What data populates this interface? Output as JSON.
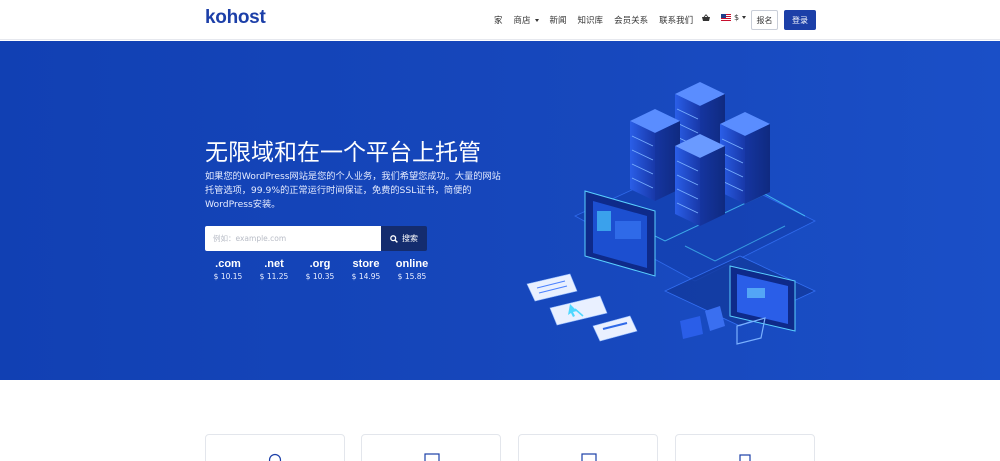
{
  "header": {
    "logo": "kohost",
    "nav": [
      {
        "label": "家",
        "dropdown": false
      },
      {
        "label": "商店",
        "dropdown": true
      },
      {
        "label": "新闻",
        "dropdown": false
      },
      {
        "label": "知识库",
        "dropdown": false
      },
      {
        "label": "会员关系",
        "dropdown": false
      },
      {
        "label": "联系我们",
        "dropdown": false
      }
    ],
    "currency": "$",
    "register_label": "报名",
    "login_label": "登录"
  },
  "hero": {
    "title": "无限域和在一个平台上托管",
    "description": "如果您的WordPress网站是您的个人业务，我们希望您成功。大量的网站托管选项，99.9%的正常运行时间保证，免费的SSL证书，简便的WordPress安装。",
    "search_placeholder": "例如：example.com",
    "search_button": "搜索",
    "tlds": [
      {
        "ext": ".com",
        "price": "$ 10.15"
      },
      {
        "ext": ".net",
        "price": "$ 11.25"
      },
      {
        "ext": ".org",
        "price": "$ 10.35"
      },
      {
        "ext": "store",
        "price": "$ 14.95"
      },
      {
        "ext": "online",
        "price": "$ 15.85"
      }
    ]
  },
  "colors": {
    "brand": "#1c3fa8",
    "hero_bg": "#1748bd",
    "search_button": "#142c6e"
  },
  "icons": [
    "cart-icon",
    "us-flag-icon",
    "search-icon",
    "server-illustration"
  ]
}
